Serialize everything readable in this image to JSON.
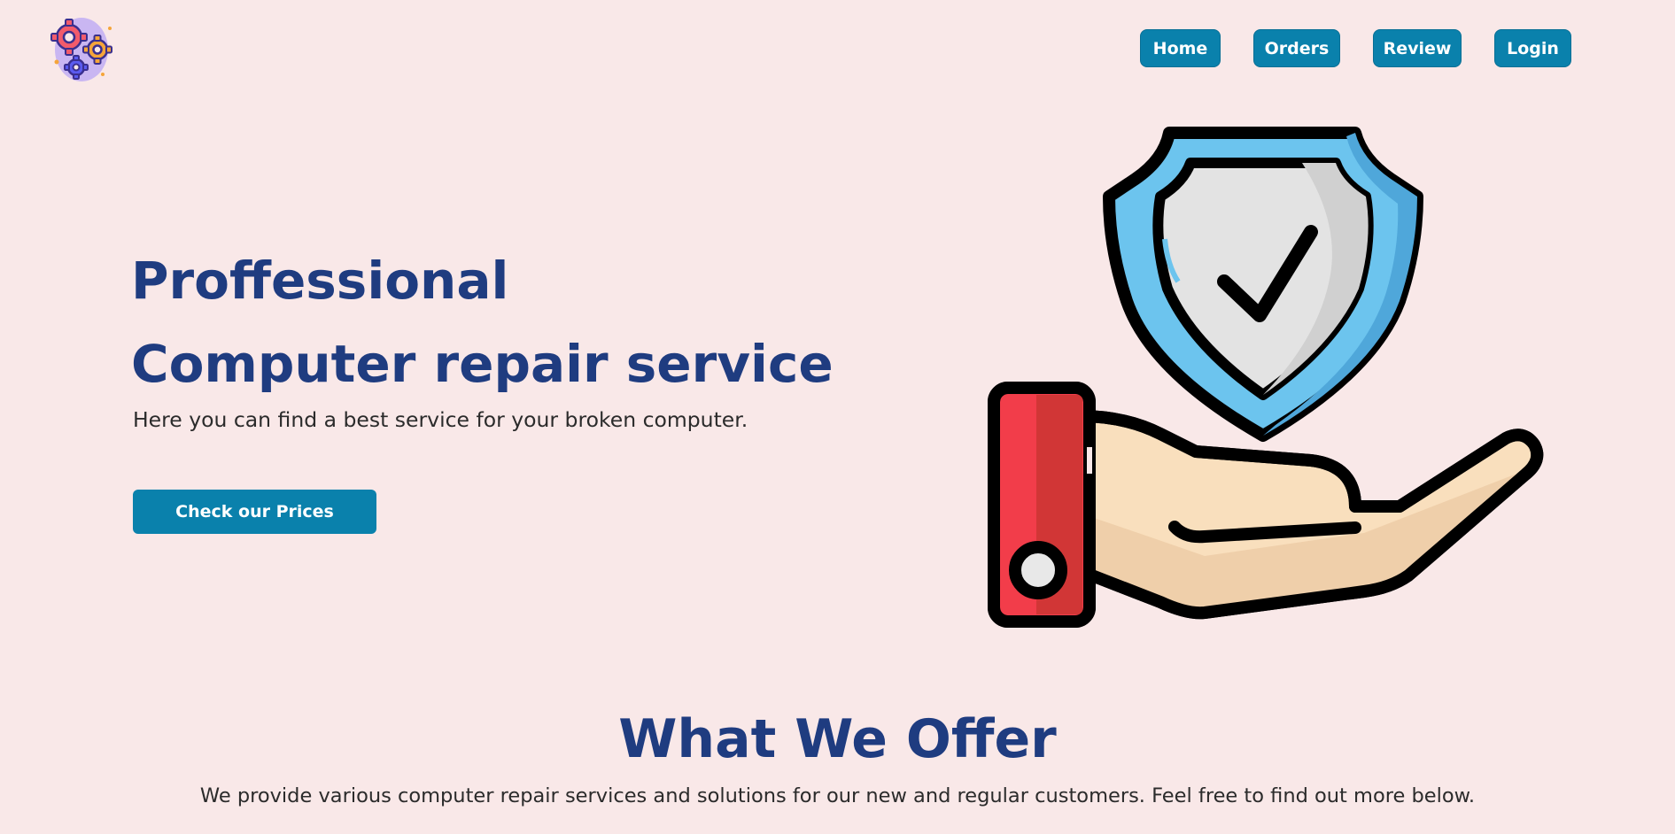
{
  "nav": {
    "home_label": "Home",
    "orders_label": "Orders",
    "review_label": "Review",
    "login_label": "Login"
  },
  "logo": {
    "icon": "gears-icon"
  },
  "hero": {
    "title_line1": "Proffessional",
    "title_line2": "Computer repair service",
    "subtitle": "Here you can find a best service for your broken computer.",
    "cta_label": "Check our Prices",
    "illustration": "hand-holding-shield-icon"
  },
  "offer": {
    "title": "What We Offer",
    "subtitle": "We provide various computer repair services and solutions for our new and regular customers. Feel free to find out more below."
  },
  "colors": {
    "background": "#f9e8e8",
    "accent": "#0a81ac",
    "heading": "#1f3c80",
    "text": "#2b2b2b"
  }
}
